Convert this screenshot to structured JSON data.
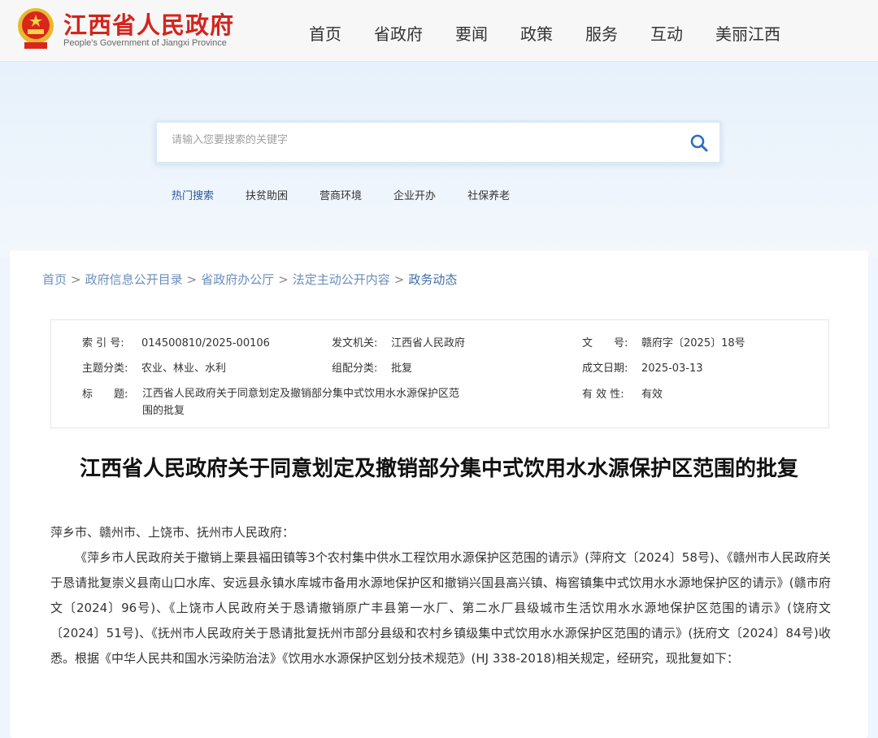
{
  "header": {
    "logo_cn": "江西省人民政府",
    "logo_en": "People's Government of Jiangxi Province",
    "nav": [
      "首页",
      "省政府",
      "要闻",
      "政策",
      "服务",
      "互动",
      "美丽江西"
    ]
  },
  "search": {
    "placeholder": "请输入您要搜索的关键字",
    "hot": [
      "热门搜索",
      "扶贫助困",
      "营商环境",
      "企业开办",
      "社保养老"
    ]
  },
  "breadcrumb": [
    "首页",
    "政府信息公开目录",
    "省政府办公厅",
    "法定主动公开内容",
    "政务动态"
  ],
  "meta": {
    "index_label": "索 引 号:",
    "index": "014500810/2025-00106",
    "issuer_label": "发文机关:",
    "issuer": "江西省人民政府",
    "docno_label": "文　　号:",
    "docno": "赣府字〔2025〕18号",
    "topic_label": "主题分类:",
    "topic": "农业、林业、水利",
    "category_label": "组配分类:",
    "category": "批复",
    "date_label": "成文日期:",
    "date": "2025-03-13",
    "title_label": "标　　题:",
    "title": "江西省人民政府关于同意划定及撤销部分集中式饮用水水源保护区范围的批复",
    "validity_label": "有 效 性:",
    "validity": "有效"
  },
  "article": {
    "title": "江西省人民政府关于同意划定及撤销部分集中式饮用水水源保护区范围的批复",
    "salutation": "萍乡市、赣州市、上饶市、抚州市人民政府：",
    "paragraph": "《萍乡市人民政府关于撤销上栗县福田镇等3个农村集中供水工程饮用水源保护区范围的请示》(萍府文〔2024〕58号)、《赣州市人民政府关于恳请批复崇义县南山口水库、安远县永镇水库城市备用水源地保护区和撤销兴国县高兴镇、梅窖镇集中式饮用水水源地保护区的请示》(赣市府文〔2024〕96号)、《上饶市人民政府关于恳请撤销原广丰县第一水厂、第二水厂县级城市生活饮用水水源地保护区范围的请示》(饶府文〔2024〕51号)、《抚州市人民政府关于恳请批复抚州市部分县级和农村乡镇级集中式饮用水水源保护区范围的请示》(抚府文〔2024〕84号)收悉。根据《中华人民共和国水污染防治法》《饮用水水源保护区划分技术规范》(HJ 338-2018)相关规定，经研究，现批复如下："
  }
}
